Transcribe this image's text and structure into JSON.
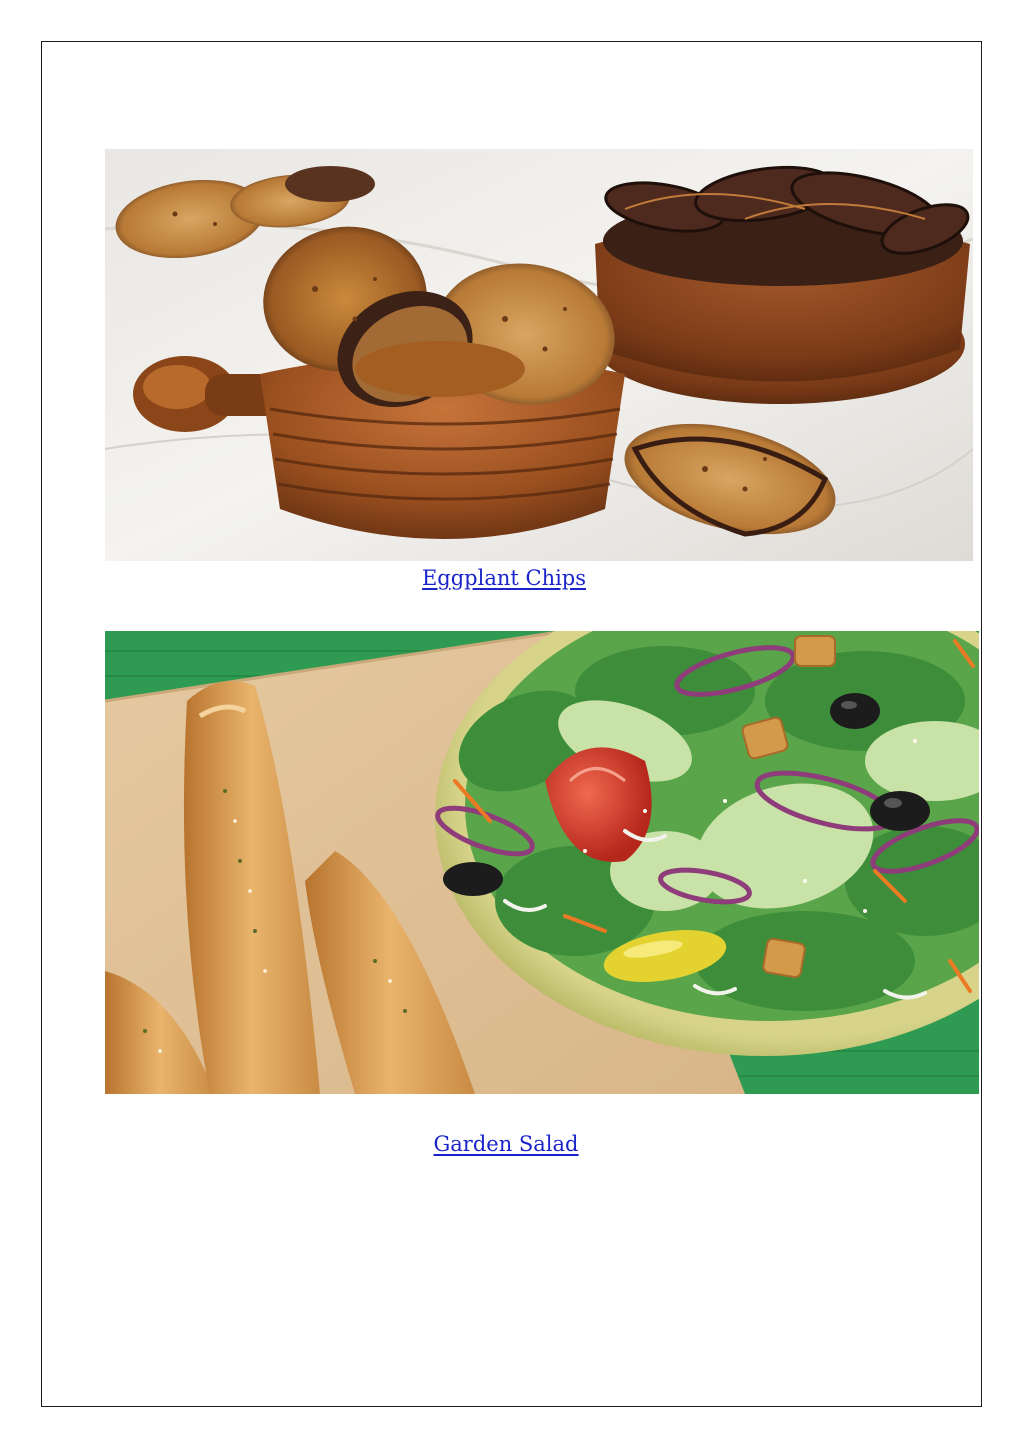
{
  "document": {
    "items": [
      {
        "caption": "Eggplant Chips",
        "image_subject": "eggplant-chips-photo"
      },
      {
        "caption": "Garden Salad",
        "image_subject": "garden-salad-breadsticks-photo"
      }
    ]
  },
  "colors": {
    "link": "#1a24c9",
    "frame_border": "#1a1a1a",
    "page_background": "#ffffff"
  }
}
